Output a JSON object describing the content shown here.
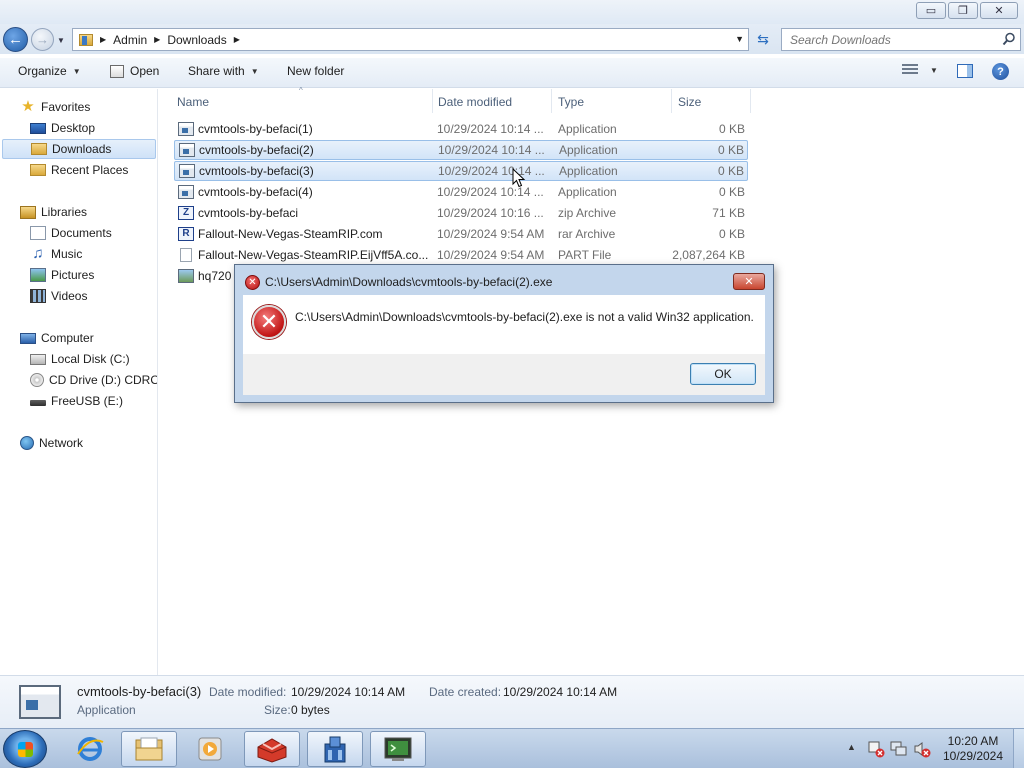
{
  "window": {
    "minimize": "▭",
    "maximize": "❐",
    "close": "✕"
  },
  "address": {
    "crumbs": [
      "Admin",
      "Downloads"
    ]
  },
  "search": {
    "placeholder": "Search Downloads"
  },
  "toolbar": {
    "organize": "Organize",
    "open": "Open",
    "share_with": "Share with",
    "new_folder": "New folder"
  },
  "nav": {
    "favorites": "Favorites",
    "desktop": "Desktop",
    "downloads": "Downloads",
    "recent_places": "Recent Places",
    "libraries": "Libraries",
    "documents": "Documents",
    "music": "Music",
    "pictures": "Pictures",
    "videos": "Videos",
    "computer": "Computer",
    "local_disk": "Local Disk (C:)",
    "cd_drive": "CD Drive (D:) CDROM",
    "freeusb": "FreeUSB (E:)",
    "network": "Network"
  },
  "columns": {
    "name": "Name",
    "date_modified": "Date modified",
    "type": "Type",
    "size": "Size"
  },
  "files": [
    {
      "name": "cvmtools-by-befaci(1)",
      "date": "10/29/2024 10:14 ...",
      "type": "Application",
      "size": "0 KB",
      "icon": "application-icon",
      "selected": false
    },
    {
      "name": "cvmtools-by-befaci(2)",
      "date": "10/29/2024 10:14 ...",
      "type": "Application",
      "size": "0 KB",
      "icon": "application-icon",
      "selected": true
    },
    {
      "name": "cvmtools-by-befaci(3)",
      "date": "10/29/2024 10:14 ...",
      "type": "Application",
      "size": "0 KB",
      "icon": "application-icon",
      "selected": true
    },
    {
      "name": "cvmtools-by-befaci(4)",
      "date": "10/29/2024 10:14 ...",
      "type": "Application",
      "size": "0 KB",
      "icon": "application-icon",
      "selected": false
    },
    {
      "name": "cvmtools-by-befaci",
      "date": "10/29/2024 10:16 ...",
      "type": "zip Archive",
      "size": "71 KB",
      "icon": "zip-archive-icon",
      "selected": false
    },
    {
      "name": "Fallout-New-Vegas-SteamRIP.com",
      "date": "10/29/2024 9:54 AM",
      "type": "rar Archive",
      "size": "0 KB",
      "icon": "rar-archive-icon",
      "selected": false
    },
    {
      "name": "Fallout-New-Vegas-SteamRIP.EijVff5A.co...",
      "date": "10/29/2024 9:54 AM",
      "type": "PART File",
      "size": "2,087,264 KB",
      "icon": "part-file-icon",
      "selected": false
    },
    {
      "name": "hq720",
      "date": "",
      "type": "",
      "size": "",
      "icon": "image-file-icon",
      "selected": false
    }
  ],
  "details": {
    "name": "cvmtools-by-befaci(3)",
    "type": "Application",
    "date_modified_label": "Date modified:",
    "date_modified": "10/29/2024 10:14 AM",
    "date_created_label": "Date created:",
    "date_created": "10/29/2024 10:14 AM",
    "size_label": "Size:",
    "size": "0 bytes"
  },
  "dialog": {
    "title": "C:\\Users\\Admin\\Downloads\\cvmtools-by-befaci(2).exe",
    "message": "C:\\Users\\Admin\\Downloads\\cvmtools-by-befaci(2).exe is not a valid Win32 application.",
    "ok": "OK",
    "close": "✕"
  },
  "taskbar": {
    "apps": [
      "internet-explorer-icon",
      "windows-explorer-icon",
      "media-player-icon",
      "red-box-app-icon",
      "blue-app-icon",
      "terminal-app-icon"
    ],
    "time": "10:20 AM",
    "date": "10/29/2024"
  }
}
